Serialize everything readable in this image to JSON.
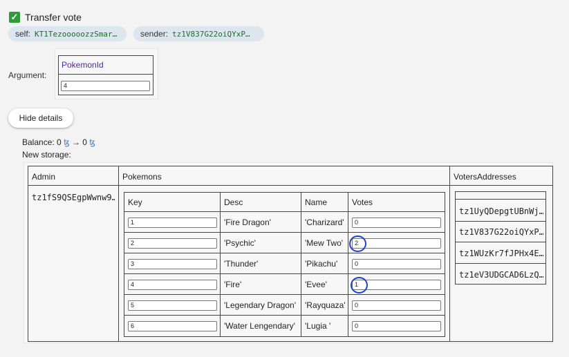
{
  "header": {
    "title": "Transfer vote",
    "self_label": "self:",
    "self_value": "KT1TezooooozzSmar…",
    "sender_label": "sender:",
    "sender_value": "tz1V837G22oiQYxP…"
  },
  "argument": {
    "label": "Argument:",
    "column": "PokemonId",
    "value": "4"
  },
  "details_button": "Hide details",
  "balance": {
    "label": "Balance: 0",
    "arrow": "→ 0",
    "tez": "ꜩ"
  },
  "new_storage_label": "New storage:",
  "storage": {
    "headers": {
      "admin": "Admin",
      "pokemons": "Pokemons",
      "voters": "VotersAddresses"
    },
    "admin_value": "tz1fS9QSEgpWwnw9…",
    "pokemon_headers": {
      "key": "Key",
      "desc": "Desc",
      "name": "Name",
      "votes": "Votes"
    },
    "pokemons": [
      {
        "key": "1",
        "desc": "'Fire Dragon'",
        "name": "'Charizard'",
        "votes": "0"
      },
      {
        "key": "2",
        "desc": "'Psychic'",
        "name": "'Mew Two'",
        "votes": "2"
      },
      {
        "key": "3",
        "desc": "'Thunder'",
        "name": "'Pikachu'",
        "votes": "0"
      },
      {
        "key": "4",
        "desc": "'Fire'",
        "name": "'Evee'",
        "votes": "1"
      },
      {
        "key": "5",
        "desc": "'Legendary Dragon'",
        "name": "'Rayquaza'",
        "votes": "0"
      },
      {
        "key": "6",
        "desc": "'Water Lengendary'",
        "name": "'Lugia '",
        "votes": "0"
      }
    ],
    "voters": [
      "tz1UyQDepgtUBnWj…",
      "tz1V837G22oiQYxP…",
      "tz1WUzKr7fJPHx4E…",
      "tz1eV3UDGCAD6LzQ…"
    ]
  },
  "colors": {
    "accent": "#4b2a96",
    "address": "#1a6e2a",
    "check": "#2e9b3a",
    "annotation": "#1f3fd6"
  }
}
